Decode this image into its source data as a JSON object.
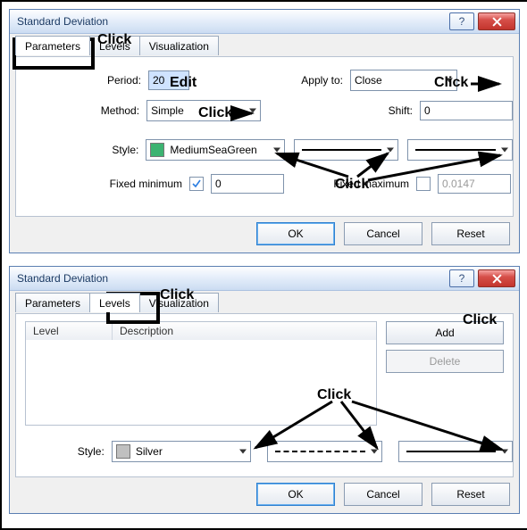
{
  "dialog1": {
    "title": "Standard Deviation",
    "tabs": [
      "Parameters",
      "Levels",
      "Visualization"
    ],
    "activeTab": 0,
    "labels": {
      "period": "Period:",
      "applyto": "Apply to:",
      "method": "Method:",
      "shift": "Shift:",
      "style": "Style:",
      "fixedmin": "Fixed minimum",
      "fixedmax": "Fixed maximum"
    },
    "values": {
      "period": "20",
      "applyto": "Close",
      "method": "Simple",
      "shift": "0",
      "color": "MediumSeaGreen",
      "colorHex": "#3cb371",
      "fixedminChecked": true,
      "fixedminVal": "0",
      "fixedmaxChecked": false,
      "fixedmaxVal": "0.0147"
    },
    "buttons": {
      "ok": "OK",
      "cancel": "Cancel",
      "reset": "Reset"
    }
  },
  "dialog2": {
    "title": "Standard Deviation",
    "tabs": [
      "Parameters",
      "Levels",
      "Visualization"
    ],
    "activeTab": 1,
    "list": {
      "col1": "Level",
      "col2": "Description"
    },
    "sidebuttons": {
      "add": "Add",
      "delete": "Delete"
    },
    "labels": {
      "style": "Style:"
    },
    "values": {
      "color": "Silver",
      "colorHex": "#c0c0c0"
    },
    "buttons": {
      "ok": "OK",
      "cancel": "Cancel",
      "reset": "Reset"
    }
  },
  "annotations": {
    "click": "Click",
    "edit": "Edit"
  }
}
